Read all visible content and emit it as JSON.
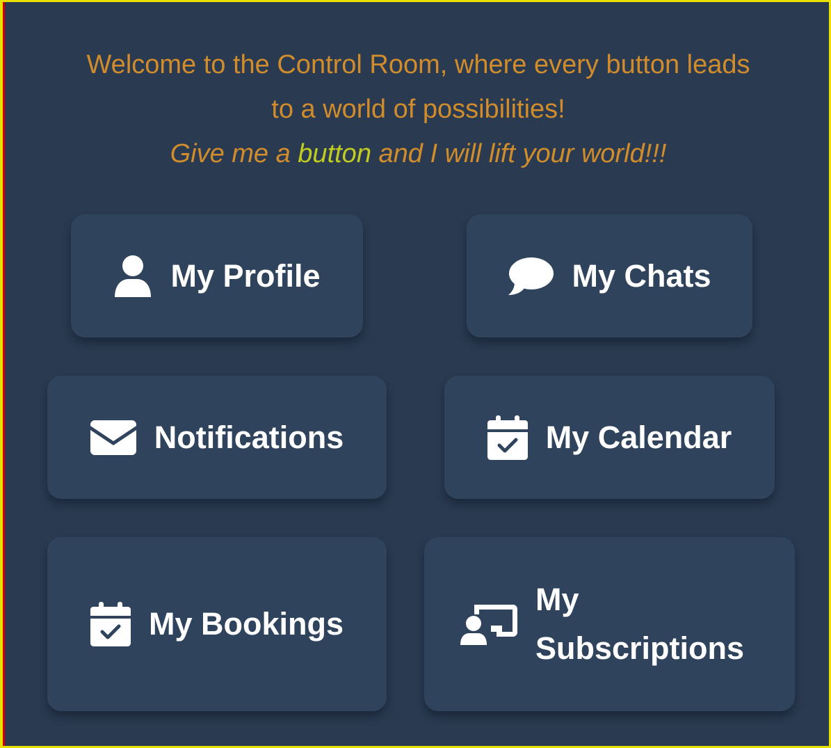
{
  "header": {
    "welcome_line1": "Welcome to the Control Room, where every button leads",
    "welcome_line2": "to a world of possibilities!",
    "tagline_before": "Give me a ",
    "tagline_highlight": "button",
    "tagline_after": " and I will lift your world!!!"
  },
  "buttons": {
    "profile": {
      "label": "My Profile",
      "icon": "user-icon"
    },
    "chats": {
      "label": "My Chats",
      "icon": "chat-bubble-icon"
    },
    "notifications": {
      "label": "Notifications",
      "icon": "envelope-icon"
    },
    "calendar": {
      "label": "My Calendar",
      "icon": "calendar-check-icon"
    },
    "bookings": {
      "label": "My Bookings",
      "icon": "calendar-check-icon"
    },
    "subscriptions": {
      "label": "My Subscriptions",
      "icon": "presentation-user-icon"
    }
  },
  "colors": {
    "background": "#2a3a50",
    "button_bg": "#2f445c",
    "welcome_text": "#d18c2c",
    "highlight_text": "#c2cc20",
    "frame_border": "#e8e000",
    "button_text": "#ffffff"
  }
}
